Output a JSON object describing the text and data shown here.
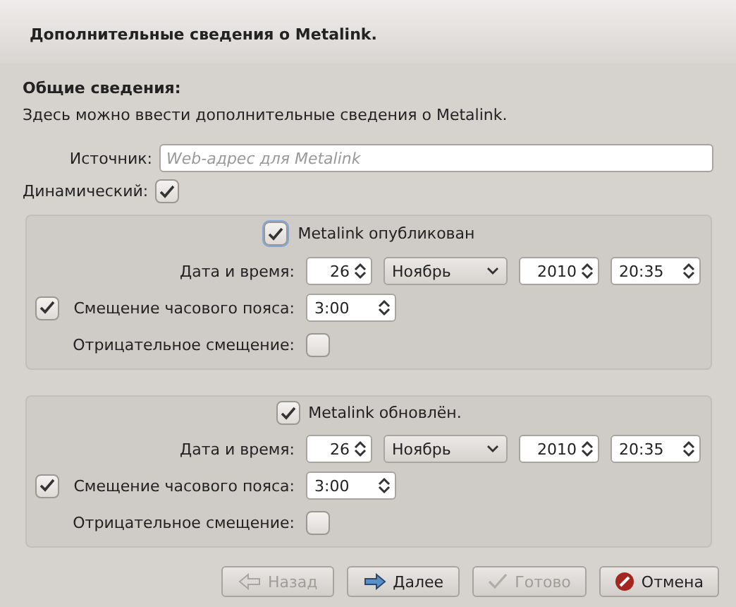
{
  "header": {
    "title": "Дополнительные сведения о Metalink."
  },
  "section": {
    "heading": "Общие сведения:",
    "description": "Здесь можно ввести дополнительные сведения о Metalink."
  },
  "source": {
    "label": "Источник:",
    "placeholder": "Web-адрес для Metalink"
  },
  "dynamic": {
    "label": "Динамический:",
    "checked": true
  },
  "groups": [
    {
      "title": "Metalink опубликован",
      "checked": true,
      "focused": true,
      "date_label": "Дата и время:",
      "day": "26",
      "month": "Ноябрь",
      "year": "2010",
      "time": "20:35",
      "offset": {
        "label": "Смещение часового пояса:",
        "checked": true,
        "value": "3:00"
      },
      "negative": {
        "label": "Отрицательное смещение:",
        "checked": false
      }
    },
    {
      "title": "Metalink обновлён.",
      "checked": true,
      "focused": false,
      "date_label": "Дата и время:",
      "day": "26",
      "month": "Ноябрь",
      "year": "2010",
      "time": "20:35",
      "offset": {
        "label": "Смещение часового пояса:",
        "checked": true,
        "value": "3:00"
      },
      "negative": {
        "label": "Отрицательное смещение:",
        "checked": false
      }
    }
  ],
  "buttons": [
    {
      "label": "Назад",
      "kind": "back",
      "disabled": true
    },
    {
      "label": "Далее",
      "kind": "next",
      "disabled": false
    },
    {
      "label": "Готово",
      "kind": "finish",
      "disabled": true
    },
    {
      "label": "Отмена",
      "kind": "cancel",
      "disabled": false
    }
  ]
}
